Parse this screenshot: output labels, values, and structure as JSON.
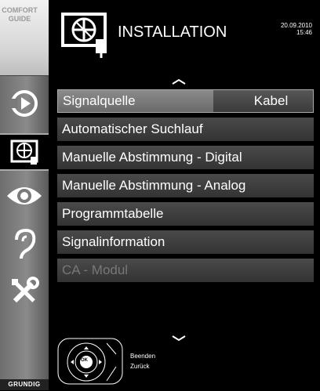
{
  "sidebar": {
    "comfort_guide_line1": "COMFORT",
    "comfort_guide_line2": "GUIDE",
    "icons": [
      "source-icon",
      "installation-icon",
      "eye-icon",
      "ear-icon",
      "tools-icon"
    ],
    "brand": "GRUNDIG"
  },
  "header": {
    "title": "INSTALLATION",
    "date": "20.09.2010",
    "time": "15:46"
  },
  "menu": {
    "items": [
      {
        "label": "Signalquelle",
        "value": "Kabel"
      },
      {
        "label": "Automatischer Suchlauf"
      },
      {
        "label": "Manuelle Abstimmung - Digital"
      },
      {
        "label": "Manuelle Abstimmung - Analog"
      },
      {
        "label": "Programmtabelle"
      },
      {
        "label": "Signalinformation"
      },
      {
        "label": "CA - Modul"
      }
    ]
  },
  "controls": {
    "ok_label": "OK",
    "exit_label": "Beenden",
    "back_label": "Zurück"
  },
  "colors": {
    "background": "#000000",
    "selected_item": "#7a7a7a",
    "menu_item": "#404040",
    "disabled_text": "#777777"
  }
}
